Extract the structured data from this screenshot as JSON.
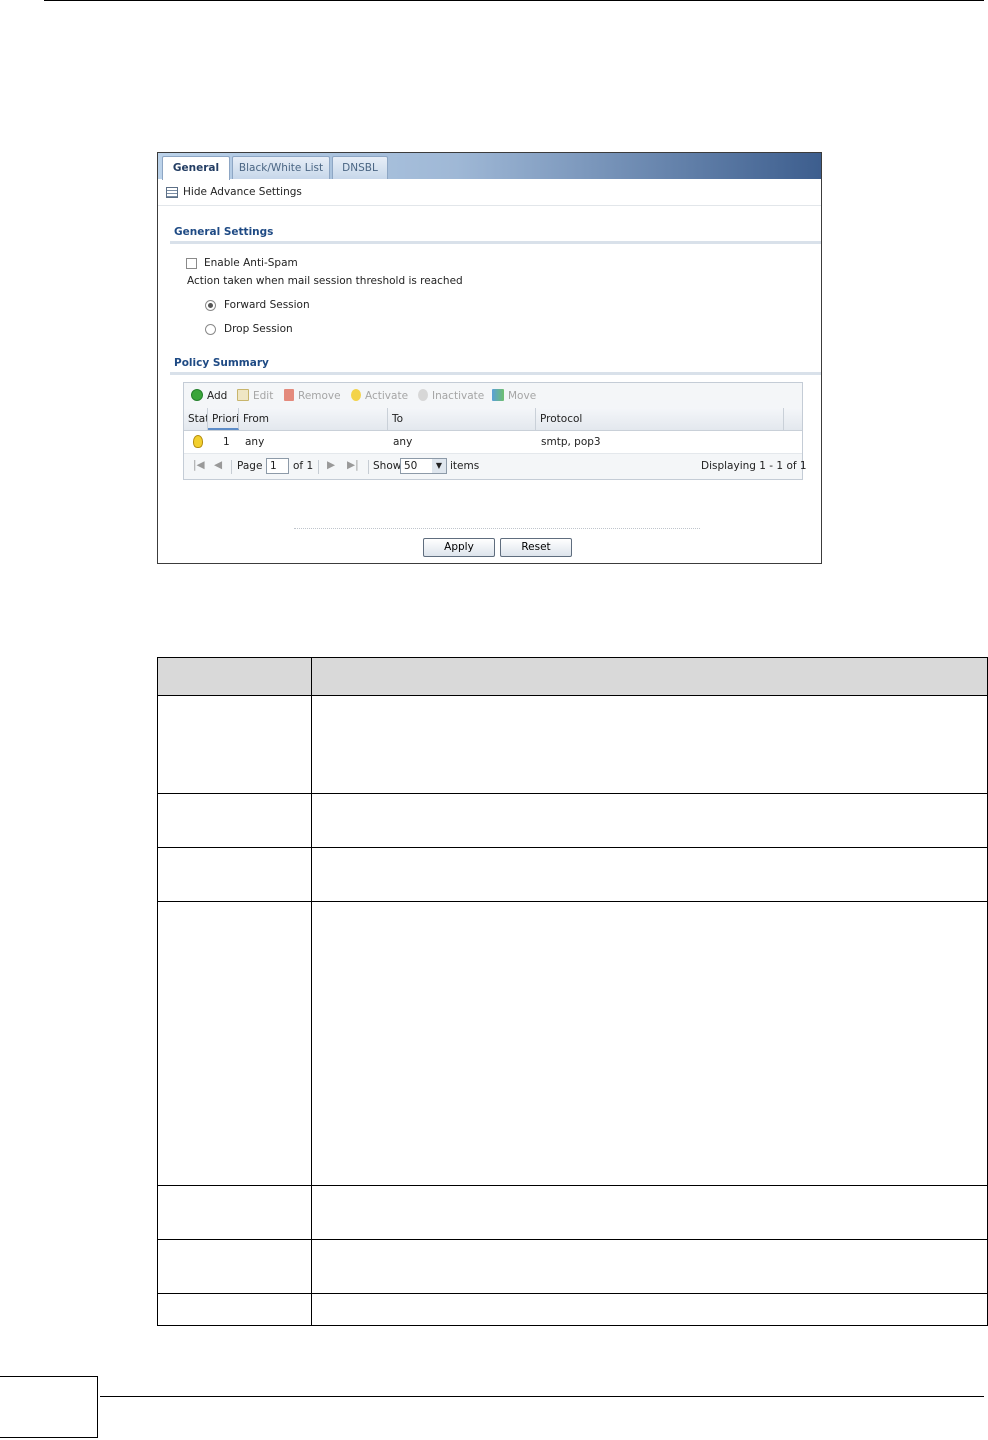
{
  "tabs": [
    {
      "label": "General",
      "active": true
    },
    {
      "label": "Black/White List",
      "active": false
    },
    {
      "label": "DNSBL",
      "active": false
    }
  ],
  "advanced_toggle": {
    "label": "Hide Advance Settings",
    "icon": "list-icon"
  },
  "general_settings": {
    "title": "General Settings",
    "enable_antispam": {
      "label": "Enable Anti-Spam",
      "checked": false
    },
    "threshold_action_label": "Action taken when mail session threshold is reached",
    "options": [
      {
        "label": "Forward Session",
        "selected": true
      },
      {
        "label": "Drop Session",
        "selected": false
      }
    ]
  },
  "policy_summary": {
    "title": "Policy Summary",
    "toolbar": [
      {
        "label": "Add",
        "icon": "add-icon",
        "enabled": true
      },
      {
        "label": "Edit",
        "icon": "edit-icon",
        "enabled": false
      },
      {
        "label": "Remove",
        "icon": "trash-icon",
        "enabled": false
      },
      {
        "label": "Activate",
        "icon": "bulb-on-icon",
        "enabled": false
      },
      {
        "label": "Inactivate",
        "icon": "bulb-off-icon",
        "enabled": false
      },
      {
        "label": "Move",
        "icon": "move-icon",
        "enabled": false
      }
    ],
    "columns": [
      "Stat",
      "Priori",
      "From",
      "To",
      "Protocol"
    ],
    "rows": [
      {
        "status_icon": "bulb-active-icon",
        "priority": "1",
        "from": "any",
        "to": "any",
        "protocol": "smtp, pop3"
      }
    ],
    "pager": {
      "page_label": "Page",
      "page_value": "1",
      "of_label": "of 1",
      "show_label": "Show",
      "show_value": "50",
      "items_label": "items",
      "displaying": "Displaying 1 - 1 of 1"
    }
  },
  "buttons": {
    "apply": "Apply",
    "reset": "Reset"
  },
  "colors": {
    "accent": "#1e4a84",
    "tab_gradient_end": "#3d5e8e",
    "table_header": "#d9d9d9"
  }
}
